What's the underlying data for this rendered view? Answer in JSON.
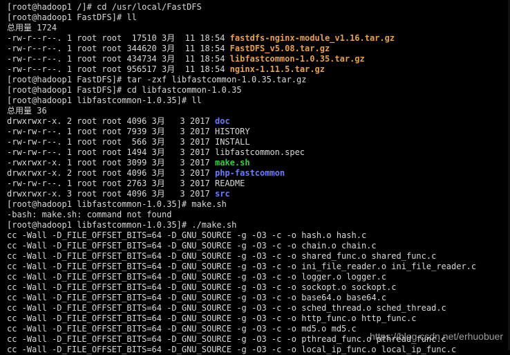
{
  "colors": {
    "background": "#000000",
    "text": "#d9d9d9",
    "archive": "#e6a04e",
    "directory": "#6b7cff",
    "executable": "#3ec93e"
  },
  "lines": [
    [
      {
        "t": "[root@hadoop1 /]# cd /usr/local/FastDFS",
        "c": "plain"
      }
    ],
    [
      {
        "t": "[root@hadoop1 FastDFS]# ll",
        "c": "plain"
      }
    ],
    [
      {
        "t": "总用量 1724",
        "c": "plain"
      }
    ],
    [
      {
        "t": "-rw-r--r--. 1 root root  17510 3月  11 18:54 ",
        "c": "plain"
      },
      {
        "t": "fastdfs-nginx-module_v1.16.tar.gz",
        "c": "tarball"
      }
    ],
    [
      {
        "t": "-rw-r--r--. 1 root root 344620 3月  11 18:54 ",
        "c": "plain"
      },
      {
        "t": "FastDFS_v5.08.tar.gz",
        "c": "tarball"
      }
    ],
    [
      {
        "t": "-rw-r--r--. 1 root root 434734 3月  11 18:54 ",
        "c": "plain"
      },
      {
        "t": "libfastcommon-1.0.35.tar.gz",
        "c": "tarball"
      }
    ],
    [
      {
        "t": "-rw-r--r--. 1 root root 956517 3月  11 18:54 ",
        "c": "plain"
      },
      {
        "t": "nginx-1.11.5.tar.gz",
        "c": "tarball"
      }
    ],
    [
      {
        "t": "[root@hadoop1 FastDFS]# tar -zxf libfastcommon-1.0.35.tar.gz",
        "c": "plain"
      }
    ],
    [
      {
        "t": "[root@hadoop1 FastDFS]# cd libfastcommon-1.0.35",
        "c": "plain"
      }
    ],
    [
      {
        "t": "[root@hadoop1 libfastcommon-1.0.35]# ll",
        "c": "plain"
      }
    ],
    [
      {
        "t": "总用量 36",
        "c": "plain"
      }
    ],
    [
      {
        "t": "drwxrwxr-x. 2 root root 4096 3月   3 2017 ",
        "c": "plain"
      },
      {
        "t": "doc",
        "c": "dir"
      }
    ],
    [
      {
        "t": "-rw-rw-r--. 1 root root 7939 3月   3 2017 HISTORY",
        "c": "plain"
      }
    ],
    [
      {
        "t": "-rw-rw-r--. 1 root root  566 3月   3 2017 INSTALL",
        "c": "plain"
      }
    ],
    [
      {
        "t": "-rw-rw-r--. 1 root root 1494 3月   3 2017 libfastcommon.spec",
        "c": "plain"
      }
    ],
    [
      {
        "t": "-rwxrwxr-x. 1 root root 3099 3月   3 2017 ",
        "c": "plain"
      },
      {
        "t": "make.sh",
        "c": "exec"
      }
    ],
    [
      {
        "t": "drwxrwxr-x. 2 root root 4096 3月   3 2017 ",
        "c": "plain"
      },
      {
        "t": "php-fastcommon",
        "c": "dir"
      }
    ],
    [
      {
        "t": "-rw-rw-r--. 1 root root 2763 3月   3 2017 README",
        "c": "plain"
      }
    ],
    [
      {
        "t": "drwxrwxr-x. 3 root root 4096 3月   3 2017 ",
        "c": "plain"
      },
      {
        "t": "src",
        "c": "dir"
      }
    ],
    [
      {
        "t": "[root@hadoop1 libfastcommon-1.0.35]# make.sh",
        "c": "plain"
      }
    ],
    [
      {
        "t": "-bash: make.sh: command not found",
        "c": "plain"
      }
    ],
    [
      {
        "t": "[root@hadoop1 libfastcommon-1.0.35]# ./make.sh",
        "c": "plain"
      }
    ],
    [
      {
        "t": "cc -Wall -D_FILE_OFFSET_BITS=64 -D_GNU_SOURCE -g -O3 -c -o hash.o hash.c",
        "c": "plain"
      }
    ],
    [
      {
        "t": "cc -Wall -D_FILE_OFFSET_BITS=64 -D_GNU_SOURCE -g -O3 -c -o chain.o chain.c",
        "c": "plain"
      }
    ],
    [
      {
        "t": "cc -Wall -D_FILE_OFFSET_BITS=64 -D_GNU_SOURCE -g -O3 -c -o shared_func.o shared_func.c",
        "c": "plain"
      }
    ],
    [
      {
        "t": "cc -Wall -D_FILE_OFFSET_BITS=64 -D_GNU_SOURCE -g -O3 -c -o ini_file_reader.o ini_file_reader.c",
        "c": "plain"
      }
    ],
    [
      {
        "t": "cc -Wall -D_FILE_OFFSET_BITS=64 -D_GNU_SOURCE -g -O3 -c -o logger.o logger.c",
        "c": "plain"
      }
    ],
    [
      {
        "t": "cc -Wall -D_FILE_OFFSET_BITS=64 -D_GNU_SOURCE -g -O3 -c -o sockopt.o sockopt.c",
        "c": "plain"
      }
    ],
    [
      {
        "t": "cc -Wall -D_FILE_OFFSET_BITS=64 -D_GNU_SOURCE -g -O3 -c -o base64.o base64.c",
        "c": "plain"
      }
    ],
    [
      {
        "t": "cc -Wall -D_FILE_OFFSET_BITS=64 -D_GNU_SOURCE -g -O3 -c -o sched_thread.o sched_thread.c",
        "c": "plain"
      }
    ],
    [
      {
        "t": "cc -Wall -D_FILE_OFFSET_BITS=64 -D_GNU_SOURCE -g -O3 -c -o http_func.o http_func.c",
        "c": "plain"
      }
    ],
    [
      {
        "t": "cc -Wall -D_FILE_OFFSET_BITS=64 -D_GNU_SOURCE -g -O3 -c -o md5.o md5.c",
        "c": "plain"
      }
    ],
    [
      {
        "t": "cc -Wall -D_FILE_OFFSET_BITS=64 -D_GNU_SOURCE -g -O3 -c -o pthread_func.o pthread_func.c",
        "c": "plain"
      }
    ],
    [
      {
        "t": "cc -Wall -D_FILE_OFFSET_BITS=64 -D_GNU_SOURCE -g -O3 -c -o local_ip_func.o local_ip_func.c",
        "c": "plain"
      }
    ]
  ],
  "watermark": "https://blog.csdn.net/erhuobuer"
}
